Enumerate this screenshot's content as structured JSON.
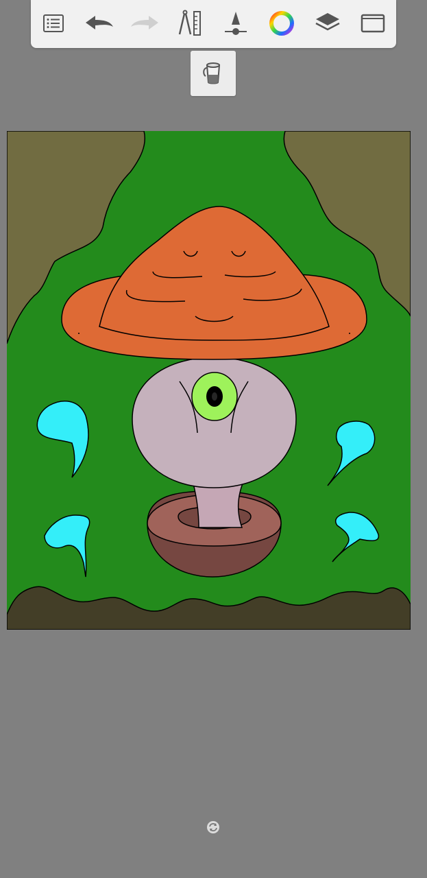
{
  "app": {
    "background_color": "#808080"
  },
  "toolbar": {
    "items": [
      {
        "name": "menu-list-icon"
      },
      {
        "name": "undo-icon"
      },
      {
        "name": "redo-icon"
      },
      {
        "name": "ruler-compass-icon"
      },
      {
        "name": "brush-size-icon"
      },
      {
        "name": "color-wheel-icon"
      },
      {
        "name": "layers-icon"
      },
      {
        "name": "fullscreen-icon"
      }
    ]
  },
  "active_tool": {
    "name": "fill-bucket-icon"
  },
  "canvas": {
    "colors": {
      "background_olive": "#716c41",
      "grass": "#238b1c",
      "ground": "#433e27",
      "hat": "#de6a35",
      "body": "#c5b1bc",
      "eye_iris": "#9ef25b",
      "eye_pupil": "#000000",
      "stem": "#c5a7b5",
      "pot_top": "#a0635a",
      "pot_side": "#764741",
      "wisps": "#34eef9"
    }
  },
  "status": {
    "sync_icon": "sync-icon"
  }
}
